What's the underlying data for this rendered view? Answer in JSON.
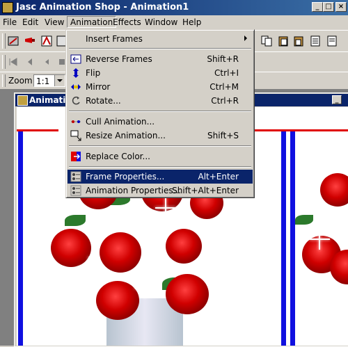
{
  "window": {
    "title": "Jasc Animation Shop - Animation1"
  },
  "menubar": [
    "File",
    "Edit",
    "View",
    "Animation",
    "Effects",
    "Window",
    "Help"
  ],
  "zoom": {
    "label": "Zoom:",
    "value": "1:1"
  },
  "child_window": {
    "title": "Animation1"
  },
  "animation_menu": {
    "items": [
      {
        "label": "Insert Frames",
        "shortcut": "",
        "submenu": true
      },
      {
        "label": "Reverse Frames",
        "shortcut": "Shift+R"
      },
      {
        "label": "Flip",
        "shortcut": "Ctrl+I"
      },
      {
        "label": "Mirror",
        "shortcut": "Ctrl+M"
      },
      {
        "label": "Rotate...",
        "shortcut": "Ctrl+R"
      },
      {
        "label": "Cull Animation...",
        "shortcut": ""
      },
      {
        "label": "Resize Animation...",
        "shortcut": "Shift+S"
      },
      {
        "label": "Replace Color...",
        "shortcut": ""
      },
      {
        "label": "Frame Properties...",
        "shortcut": "Alt+Enter",
        "selected": true
      },
      {
        "label": "Animation Properties...",
        "shortcut": "Shift+Alt+Enter"
      }
    ]
  },
  "colors": {
    "highlight": "#0a246a",
    "frame_border": "#1010e0",
    "marker": "#e00000"
  }
}
